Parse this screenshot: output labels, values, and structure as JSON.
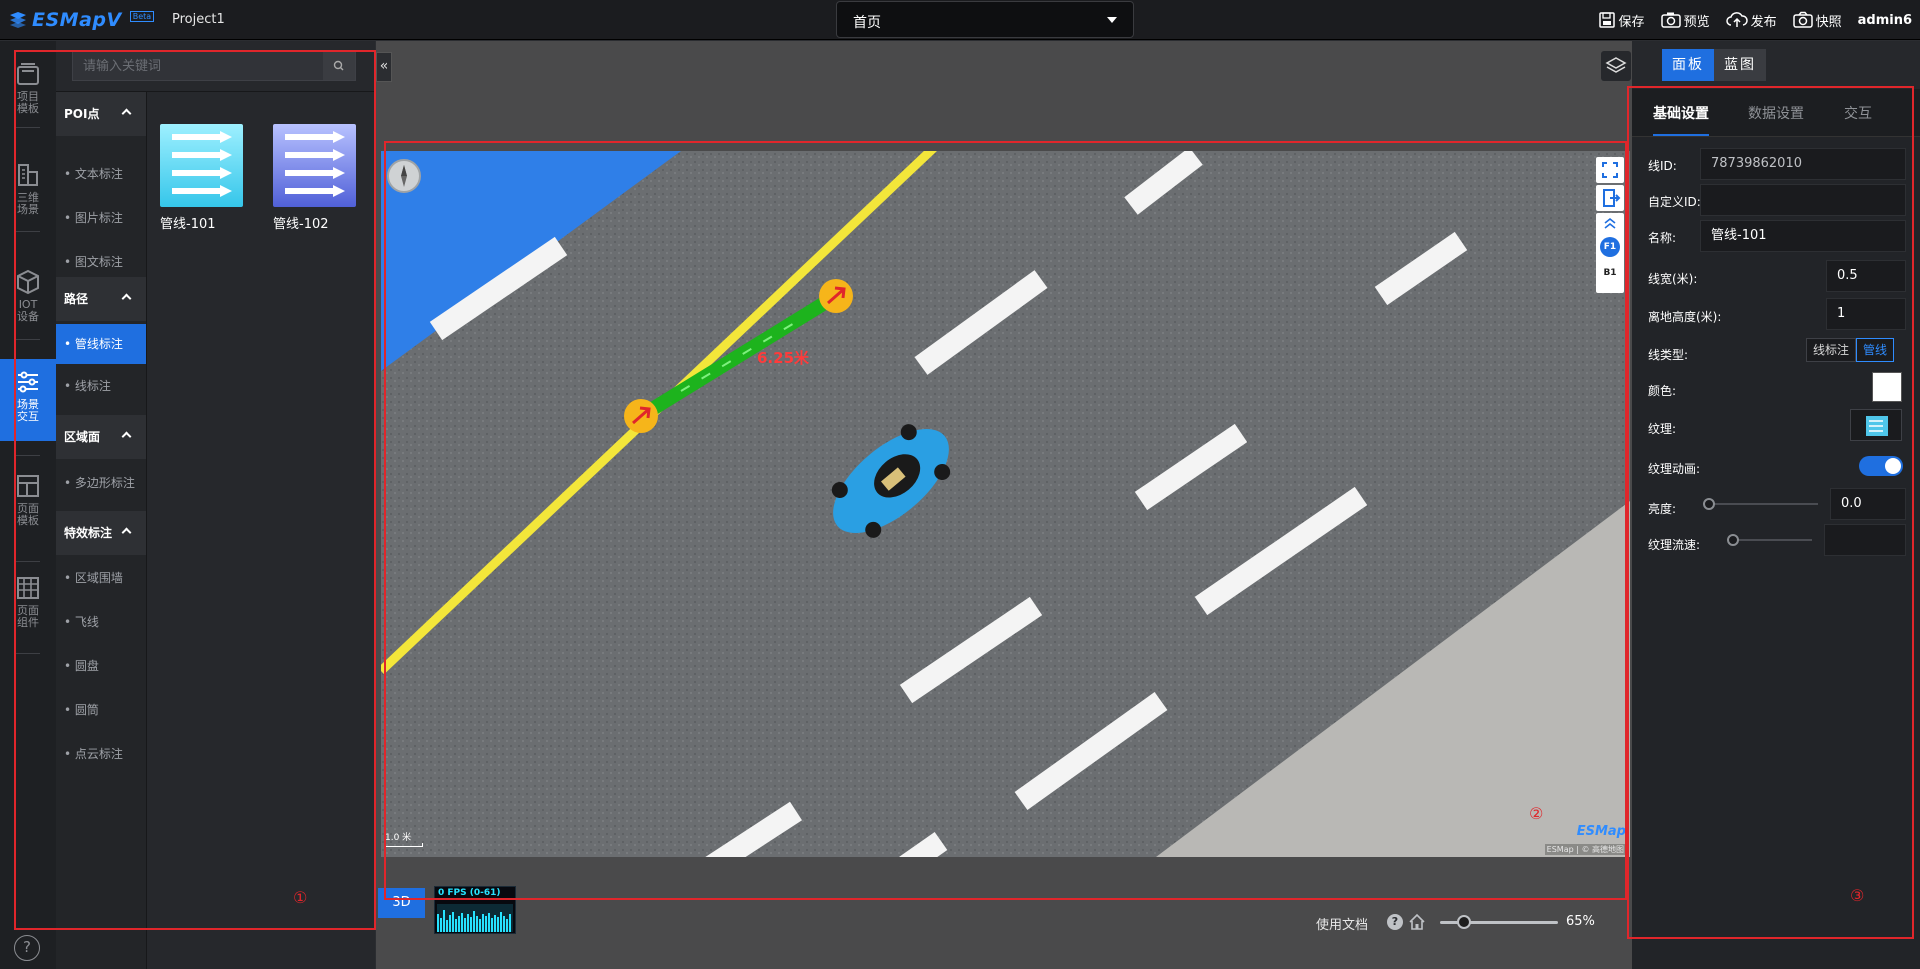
{
  "topbar": {
    "logo_text": "ESMapV",
    "logo_badge": "Beta",
    "project_name": "Project1",
    "page_select_value": "首页",
    "actions": [
      {
        "label": "保存",
        "icon": "save-icon"
      },
      {
        "label": "预览",
        "icon": "camera-icon"
      },
      {
        "label": "发布",
        "icon": "cloud-upload-icon"
      },
      {
        "label": "快照",
        "icon": "snapshot-icon"
      }
    ],
    "user": "admin6"
  },
  "rail": {
    "items": [
      {
        "label": "项目模板",
        "icon": "project-template-icon"
      },
      {
        "label": "三维场景",
        "icon": "3d-scene-icon"
      },
      {
        "label": "IOT设备",
        "icon": "iot-device-icon"
      },
      {
        "label": "场景交互",
        "icon": "scene-interaction-icon"
      },
      {
        "label": "页面模板",
        "icon": "page-template-icon"
      },
      {
        "label": "页面组件",
        "icon": "page-component-icon"
      }
    ],
    "active_index": 3
  },
  "library": {
    "search_placeholder": "请输入关键词",
    "groups": [
      {
        "title": "POI点",
        "items": [
          "文本标注",
          "图片标注",
          "图文标注"
        ]
      },
      {
        "title": "路径",
        "items": [
          "管线标注",
          "线标注"
        ]
      },
      {
        "title": "区域面",
        "items": [
          "多边形标注"
        ]
      },
      {
        "title": "特效标注",
        "items": [
          "区域围墙",
          "飞线",
          "圆盘",
          "圆筒",
          "点云标注"
        ]
      }
    ],
    "active_item": "管线标注",
    "assets": [
      {
        "name": "管线-101",
        "color": "#5fd6ef"
      },
      {
        "name": "管线-102",
        "color": "#6f7fe8"
      }
    ]
  },
  "viewport": {
    "distance_label": "6.25米",
    "scale_label": "1.0 米",
    "brand": "ESMap",
    "attribution": "ESMap | © 高德地图",
    "floor_buttons": [
      "F1",
      "B1"
    ],
    "mode_label": "3D",
    "fps_label": "0 FPS (0-61)",
    "doc_link": "使用文档",
    "help_label": "?",
    "zoom_percent": "65%",
    "zoom_value": 0.2
  },
  "properties": {
    "tabs": [
      "面板",
      "蓝图"
    ],
    "active_tab": "面板",
    "subtabs": [
      "基础设置",
      "数据设置",
      "交互"
    ],
    "active_subtab": "基础设置",
    "fields": {
      "line_id_label": "线ID:",
      "line_id_value": "78739862010",
      "custom_id_label": "自定义ID:",
      "custom_id_value": "",
      "name_label": "名称:",
      "name_value": "管线-101",
      "width_label": "线宽(米):",
      "width_value": "0.5",
      "height_label": "离地高度(米):",
      "height_value": "1",
      "linetype_label": "线类型:",
      "linetype_options": [
        "线标注",
        "管线"
      ],
      "linetype_selected": "管线",
      "color_label": "颜色:",
      "color_value": "#ffffff",
      "texture_label": "纹理:",
      "texture_anim_label": "纹理动画:",
      "texture_anim_on": true,
      "brightness_label": "亮度:",
      "brightness_value": "0.0",
      "flow_label": "纹理流速:",
      "flow_value": ""
    }
  },
  "annotations": [
    "①",
    "②",
    "③"
  ],
  "colors": {
    "accent": "#1f6fe0",
    "annotation": "#e0262b",
    "pipeline": "#1db31d",
    "road_line_yellow": "#f3e63a"
  }
}
